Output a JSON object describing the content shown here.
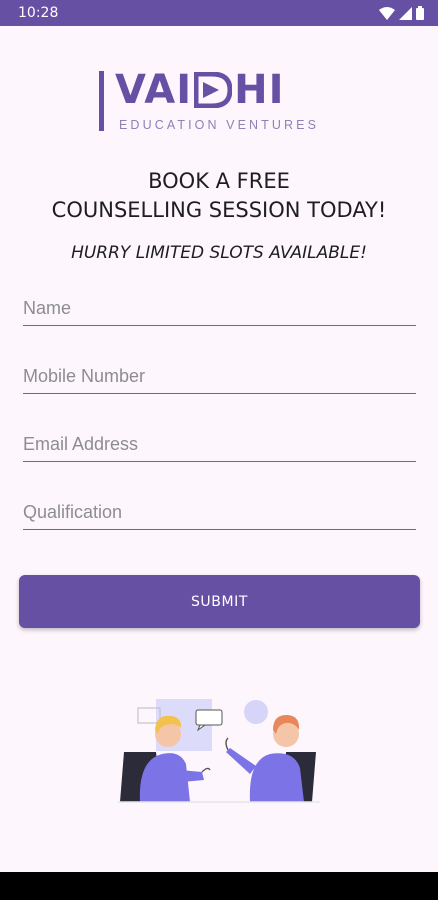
{
  "status_bar": {
    "time": "10:28",
    "background_color": "#6650a4",
    "icons": [
      "wifi-icon",
      "signal-icon",
      "battery-icon"
    ]
  },
  "logo": {
    "word_left": "VAI",
    "word_right": "HI",
    "tagline": "EDUCATION VENTURES",
    "brand_color": "#6650a4"
  },
  "heading": {
    "line1": "BOOK A FREE",
    "line2": "COUNSELLING SESSION TODAY!"
  },
  "subheading": "HURRY LIMITED SLOTS AVAILABLE!",
  "form": {
    "fields": [
      {
        "placeholder": "Name",
        "value": ""
      },
      {
        "placeholder": "Mobile Number",
        "value": ""
      },
      {
        "placeholder": "Email Address",
        "value": ""
      },
      {
        "placeholder": "Qualification",
        "value": ""
      }
    ],
    "submit_label": "SUBMIT"
  },
  "illustration": "two-people-talking-illustration",
  "colors": {
    "accent": "#6650a4",
    "background": "#fdf7fd",
    "illustration_primary": "#7b73e6"
  }
}
